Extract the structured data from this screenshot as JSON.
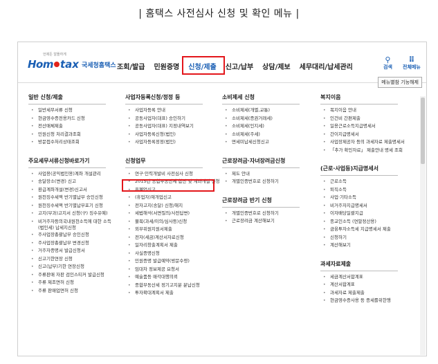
{
  "caption": "| 홈택스 사전심사 신청 및 확인 메뉴 |",
  "logo": {
    "hom": "Hom",
    "tax": "tax",
    "nts": "국세청홈택스",
    "sub": "언제든 알뜰하게"
  },
  "nav": [
    "조회/발급",
    "민원증명",
    "신청/제출",
    "신고/납부",
    "상담/제보",
    "세무대리/납세관리"
  ],
  "right_icons": {
    "search": "검색",
    "all_menu": "전체메뉴"
  },
  "help_button": "메뉴별참 기능해제",
  "columns": [
    {
      "sections": [
        {
          "title": "일반 신청/제출",
          "items": [
            "일반세무서류 신청",
            "현금영수증전용카드 신청",
            "전산매체제출",
            "민원신청 처리결과조회",
            "방문접수처리상태조회"
          ]
        },
        {
          "title": "주요세무서류신청바로가기",
          "items": [
            "사업용(공익법인용)계좌 개설관리",
            "송달장소(변경) 신고",
            "환급계좌개설(변경)신고서",
            "원천징수세액 반기별납부 승인신청",
            "원천징수세액 반기별납부포기 신청",
            "고지(부과)고지서 신청(구) 징수유예)",
            "비거주자등의국내원천소득에 대한 소득(법인세) 납세지신청",
            "주사업장총괄납부 승인신청",
            "주사업장총괄납부 변경신청",
            "거주자증명서 발급신청서",
            "신고기한연장 신청",
            "신고(납부)기한 연장신청",
            "주류판매 자판 검인스티커 발급신청",
            "주류 제조면허 신청",
            "주류 판매업면허 신청"
          ]
        }
      ]
    },
    {
      "sections": [
        {
          "title": "사업자등록신청/정정 등",
          "items": [
            "사업자등록 안내",
            "공동사업자(대표) 승인하기",
            "공동사업자(대표) 지정내역보기",
            "사업자등록신청(법인)",
            "사업자등록정정(법인)"
          ]
        },
        {
          "title": "신청업무",
          "items": [
            "연구·인력개발비 사전심사 신청",
            "2015년 종합부동산세 합산 및 계좌개설 신청",
            "휴폐업신고",
            "(휴업자)재개업신고",
            "전자고지(송달) 신청/해지",
            "세법해석(서면질의/사전답변)",
            "불복(과세/이의/심사등)신청",
            "외부위원지원서제출",
            "전자(세금)계산서자료신청",
            "일자리창출계획서 제출",
            "사실증명신청",
            "민원증명 발급예약(방문수령)",
            "임대차 정보제공 요청서",
            "예술품등 매각대행의뢰",
            "종합부동산세 정기고지분 분납신청",
            "투자확대계획서 제출"
          ]
        }
      ]
    },
    {
      "sections": [
        {
          "title": "소비제세 신청",
          "items": [
            "소비제세(개별,교통)",
            "소비제세(증권거래세)",
            "소비제세(인지세)",
            "소비제세(주세)",
            "면세미납세신청신고"
          ]
        },
        {
          "title": "근로장려금·자녀장려금신청",
          "items": [
            "제도 안내",
            "개별인증번호로 신청하기"
          ]
        },
        {
          "title": "근로장려금 반기 신청",
          "items": [
            "개별인증번호로 신청하기",
            "근로장려금 계산해보기"
          ]
        }
      ]
    },
    {
      "sections": [
        {
          "title": "복지이음",
          "items": [
            "복지이음 안내",
            "인건비 간편제출",
            "일용근로소득지급명세서",
            "간이지급명세서",
            "사업장제공자 등의 과세자료 제출명세서",
            "「추가 확인자료」 제출안내 명세 조회"
          ]
        },
        {
          "title": "(근로·사업등)지급명세서",
          "items": [
            "근로소득",
            "퇴직소득",
            "사업·기타소득",
            "비거주자지급명세서",
            "이자배당일괄지급",
            "종교인소득 (연말정산용)",
            "금융투자소득세 지급명세서 제출",
            "신청하기",
            "계산해보기"
          ]
        },
        {
          "title": "과세자료제출",
          "items": [
            "세금계산서합계표",
            "계산서합계표",
            "과세자료 제출제출",
            "현금영수증사용 등 증세를위한행"
          ]
        }
      ]
    }
  ]
}
